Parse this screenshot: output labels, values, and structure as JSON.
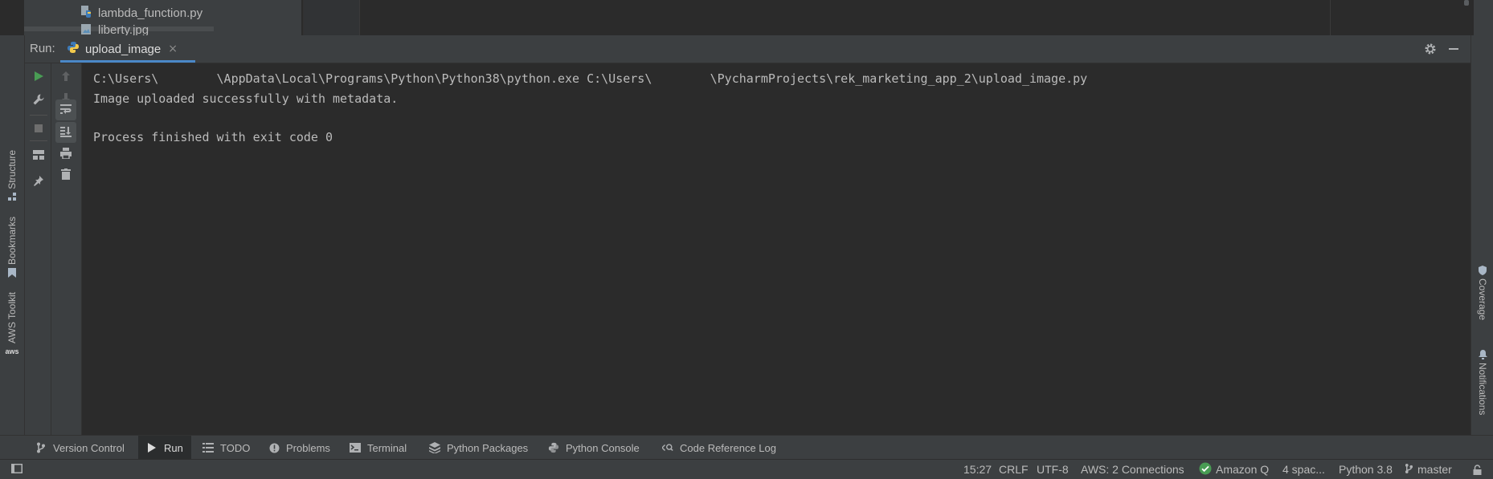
{
  "project_tree": {
    "items": [
      {
        "label": "lambda_function.py",
        "icon": "python-file-icon"
      },
      {
        "label": "liberty.jpg",
        "icon": "image-file-icon"
      }
    ]
  },
  "run_panel": {
    "label": "Run:",
    "tab": {
      "name": "upload_image",
      "icon": "python-icon",
      "close": "×"
    }
  },
  "console": {
    "lines": [
      "C:\\Users\\        \\AppData\\Local\\Programs\\Python\\Python38\\python.exe C:\\Users\\        \\PycharmProjects\\rek_marketing_app_2\\upload_image.py",
      "Image uploaded successfully with metadata.",
      "",
      "Process finished with exit code 0"
    ]
  },
  "left_stripe": {
    "tabs": [
      {
        "label": "Structure",
        "icon": "structure-icon"
      },
      {
        "label": "Bookmarks",
        "icon": "bookmark-icon"
      },
      {
        "label": "AWS Toolkit",
        "icon": "aws-icon",
        "icon_text": "aws"
      }
    ]
  },
  "right_stripe": {
    "tabs": [
      {
        "label": "Coverage",
        "icon": "shield-icon"
      },
      {
        "label": "Notifications",
        "icon": "bell-icon"
      }
    ]
  },
  "bottom_tabs": [
    {
      "label": "Version Control",
      "icon": "git-branch-icon"
    },
    {
      "label": "Run",
      "icon": "play-icon",
      "active": true
    },
    {
      "label": "TODO",
      "icon": "list-icon"
    },
    {
      "label": "Problems",
      "icon": "warning-icon"
    },
    {
      "label": "Terminal",
      "icon": "terminal-icon"
    },
    {
      "label": "Python Packages",
      "icon": "packages-icon"
    },
    {
      "label": "Python Console",
      "icon": "python-icon"
    },
    {
      "label": "Code Reference Log",
      "icon": "code-log-icon"
    }
  ],
  "status_bar": {
    "time": "15:27",
    "line_sep": "CRLF",
    "encoding": "UTF-8",
    "aws": "AWS: 2 Connections",
    "amazon_q": "Amazon Q",
    "indent": "4 spac...",
    "interpreter": "Python 3.8",
    "branch": "master"
  },
  "colors": {
    "run_green": "#499c54",
    "tab_underline": "#4a88c7",
    "python_blue": "#3d7ab8",
    "python_yellow": "#f2c94c"
  }
}
